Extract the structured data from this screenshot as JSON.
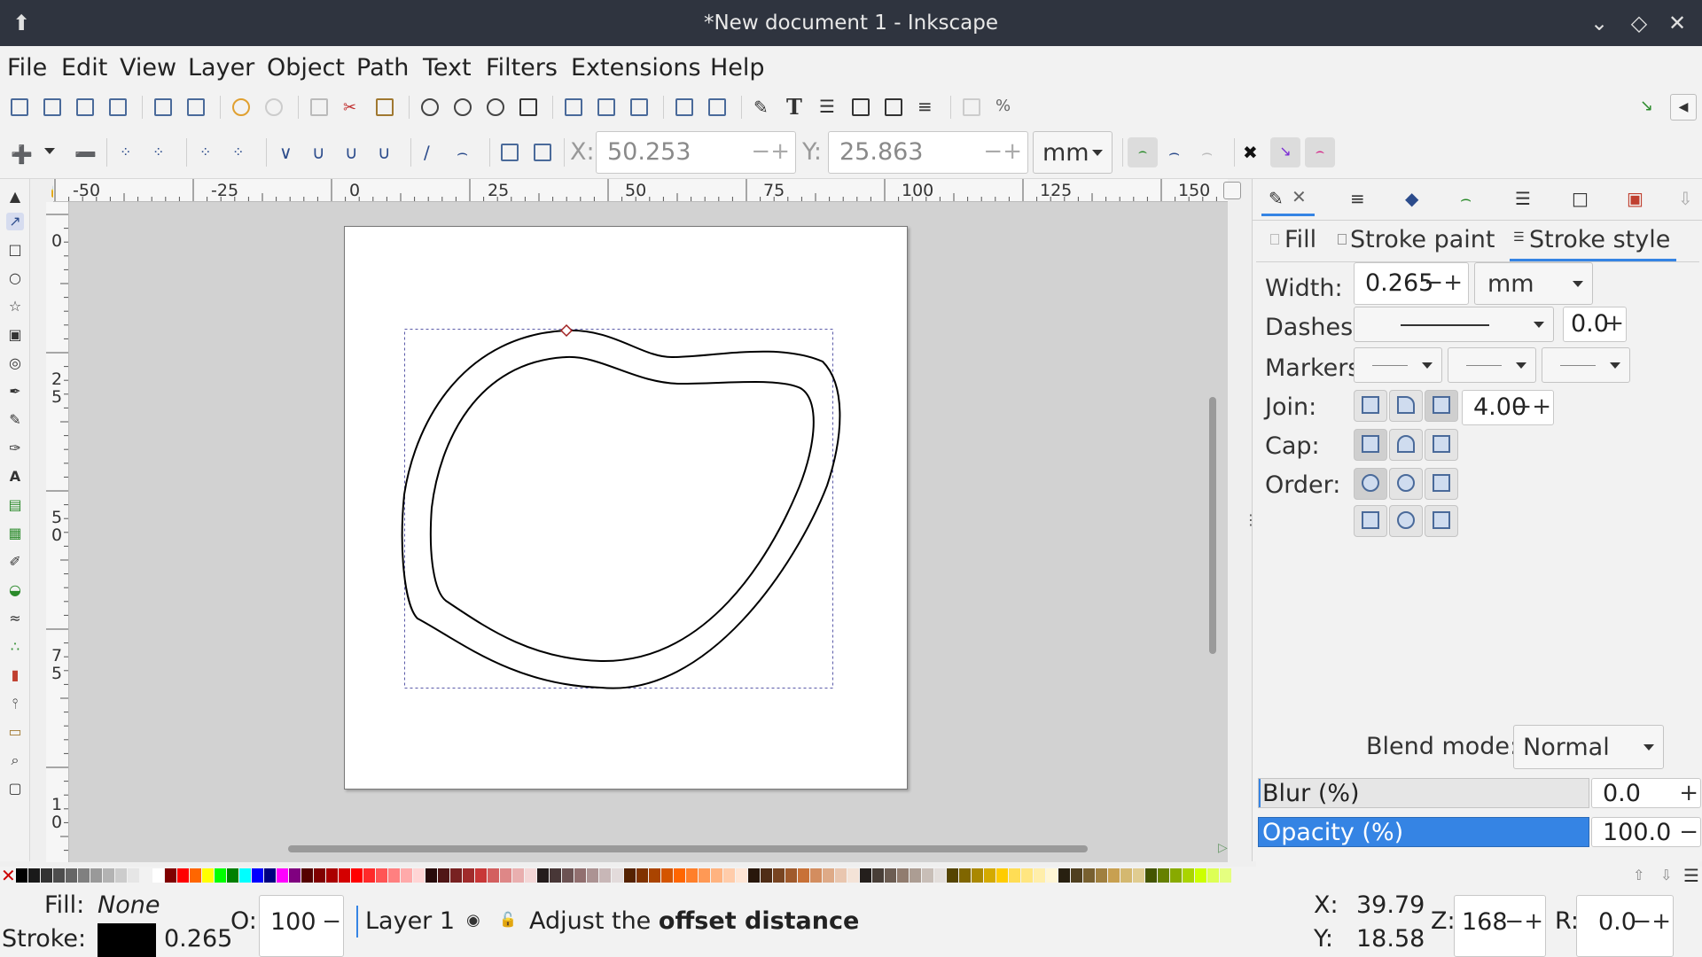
{
  "window": {
    "title": "*New document 1 - Inkscape",
    "icons": [
      "inkscape-logo-icon",
      "minimize-icon",
      "maximize-icon",
      "close-icon"
    ]
  },
  "menu": [
    "File",
    "Edit",
    "View",
    "Layer",
    "Object",
    "Path",
    "Text",
    "Filters",
    "Extensions",
    "Help"
  ],
  "controls": {
    "x_label": "X:",
    "x_value": "50.253",
    "y_label": "Y:",
    "y_value": "25.863",
    "unit": "mm"
  },
  "hruler": {
    "labels": [
      "-50",
      "-25",
      "0",
      "25",
      "50",
      "75",
      "100",
      "125",
      "150"
    ]
  },
  "vruler": {
    "labels": [
      "0",
      "2\n5",
      "5\n0",
      "7\n5",
      "1\n0"
    ]
  },
  "dock": {
    "tabs": [
      "Fill",
      "Stroke paint",
      "Stroke style"
    ],
    "active_tab": "Stroke style",
    "width_label": "Width:",
    "width_value": "0.265",
    "width_unit": "mm",
    "dashes_label": "Dashes:",
    "dashes_value": "0.0",
    "markers_label": "Markers:",
    "join_label": "Join:",
    "join_value": "4.00",
    "cap_label": "Cap:",
    "order_label": "Order:",
    "blend_label": "Blend mode:",
    "blend_value": "Normal",
    "blur_label": "Blur (%)",
    "blur_value": "0.0",
    "opacity_label": "Opacity (%)",
    "opacity_value": "100.0"
  },
  "status": {
    "fill_label": "Fill:",
    "fill_value": "None",
    "stroke_label": "Stroke:",
    "stroke_width": "0.265",
    "opacity_label": "O:",
    "opacity_value": "100",
    "layer": "Layer 1",
    "message_prefix": "Adjust the ",
    "message_bold": "offset distance",
    "x_label": "X:",
    "x_value": "39.79",
    "y_label": "Y:",
    "y_value": "18.58",
    "zoom_label": "Z:",
    "zoom_value": "168",
    "rotate_label": "R:",
    "rotate_value": "0.0"
  },
  "colors": {
    "titlebar": "#2f343f",
    "accent": "#3584e4",
    "canvas_bg": "#d2d2d2"
  },
  "palette": [
    "#000000",
    "#1a1a1a",
    "#333333",
    "#4d4d4d",
    "#666666",
    "#808080",
    "#999999",
    "#b3b3b3",
    "#cccccc",
    "#e6e6e6",
    "#f2f2f2",
    "#ffffff",
    "#800000",
    "#ff0000",
    "#ff6600",
    "#ffff00",
    "#00ff00",
    "#008000",
    "#00ffff",
    "#0000ff",
    "#000080",
    "#ff00ff",
    "#800080",
    "#550000",
    "#800000",
    "#aa0000",
    "#d40000",
    "#ff0000",
    "#ff2a2a",
    "#ff5555",
    "#ff8080",
    "#ffaaaa",
    "#ffd5d5",
    "#280b0b",
    "#501616",
    "#782121",
    "#a02c2c",
    "#c83737",
    "#d35f5f",
    "#de8787",
    "#e9afaf",
    "#f4d7d7",
    "#241c1c",
    "#483737",
    "#6c5353",
    "#916f6f",
    "#ac9393",
    "#c8b7b7",
    "#e3dbdb",
    "#552200",
    "#803300",
    "#aa4400",
    "#d45500",
    "#ff6600",
    "#ff7f2a",
    "#ff9955",
    "#ffb380",
    "#ffccaa",
    "#ffe6d5",
    "#28170b",
    "#502d16",
    "#784421",
    "#a05a2c",
    "#c87137",
    "#d38d5f",
    "#deaa87",
    "#e9c6af",
    "#f4e3d7",
    "#241f1c",
    "#483e37",
    "#6c5d53",
    "#917c6f",
    "#ac9d93",
    "#c8beb7",
    "#e3dedb",
    "#554400",
    "#806600",
    "#aa8800",
    "#d4aa00",
    "#ffcc00",
    "#ffdd55",
    "#ffe680",
    "#ffeeaa",
    "#fff6d5",
    "#282010",
    "#504020",
    "#786030",
    "#a08040",
    "#c8a050",
    "#d4b870",
    "#e0cc90",
    "#445500",
    "#668000",
    "#88aa00",
    "#aad400",
    "#ccff00",
    "#ddff55",
    "#e5ff80"
  ]
}
